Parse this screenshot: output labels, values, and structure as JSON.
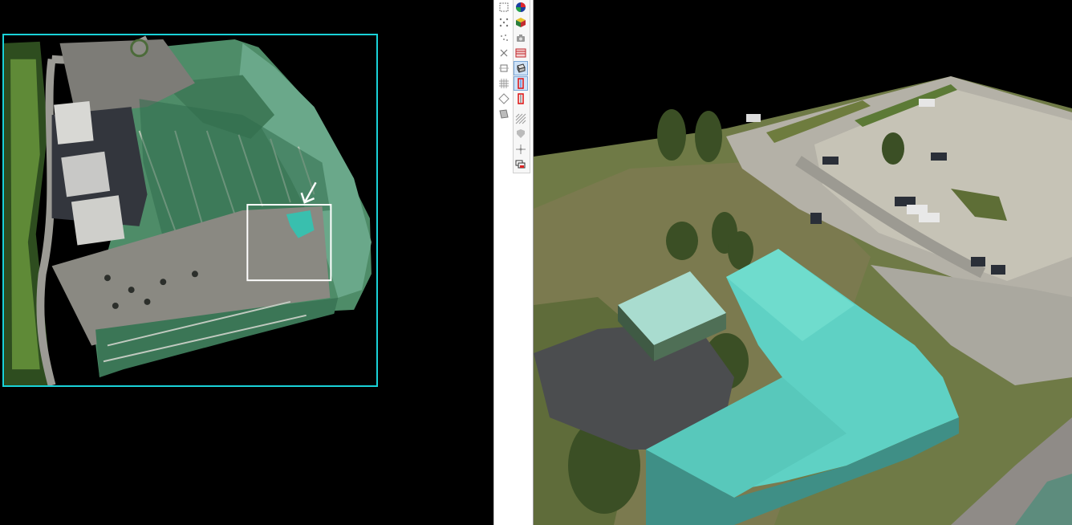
{
  "left_panel": {
    "view": "orthomosaic-overview",
    "frame_color": "#19d2d8",
    "selection_color": "#ffffff"
  },
  "toolbar": {
    "column_a": [
      {
        "icon": "zoom-window-icon",
        "pressed": false
      },
      {
        "icon": "mesh-points-icon",
        "pressed": false
      },
      {
        "icon": "sparse-points-icon",
        "pressed": false
      },
      {
        "icon": "clear-selection-icon",
        "pressed": false
      },
      {
        "icon": "crop-region-icon",
        "pressed": false
      },
      {
        "icon": "grid-icon",
        "pressed": false
      },
      {
        "icon": "diamond-region-icon",
        "pressed": false
      },
      {
        "icon": "transform-icon",
        "pressed": false
      }
    ],
    "column_b": [
      {
        "icon": "color-sphere-icon",
        "pressed": false
      },
      {
        "icon": "texture-cube-icon",
        "pressed": false
      },
      {
        "icon": "camera-icon",
        "pressed": false
      },
      {
        "icon": "image-strip-icon",
        "pressed": false
      },
      {
        "icon": "box-3d-icon",
        "pressed": true
      },
      {
        "icon": "red-frame-icon",
        "pressed": true
      },
      {
        "icon": "red-frame-alt-icon",
        "pressed": false
      },
      {
        "icon": "hatch-icon",
        "pressed": false
      },
      {
        "icon": "shield-icon",
        "pressed": false
      },
      {
        "icon": "move-axes-icon",
        "pressed": false
      },
      {
        "icon": "layers-icon",
        "pressed": false
      }
    ]
  },
  "right_panel": {
    "view": "3d-textured-model",
    "roof_color": "#5fd1c4",
    "lot_color": "#b4b1a7",
    "grass_color": "#6f7a46"
  }
}
